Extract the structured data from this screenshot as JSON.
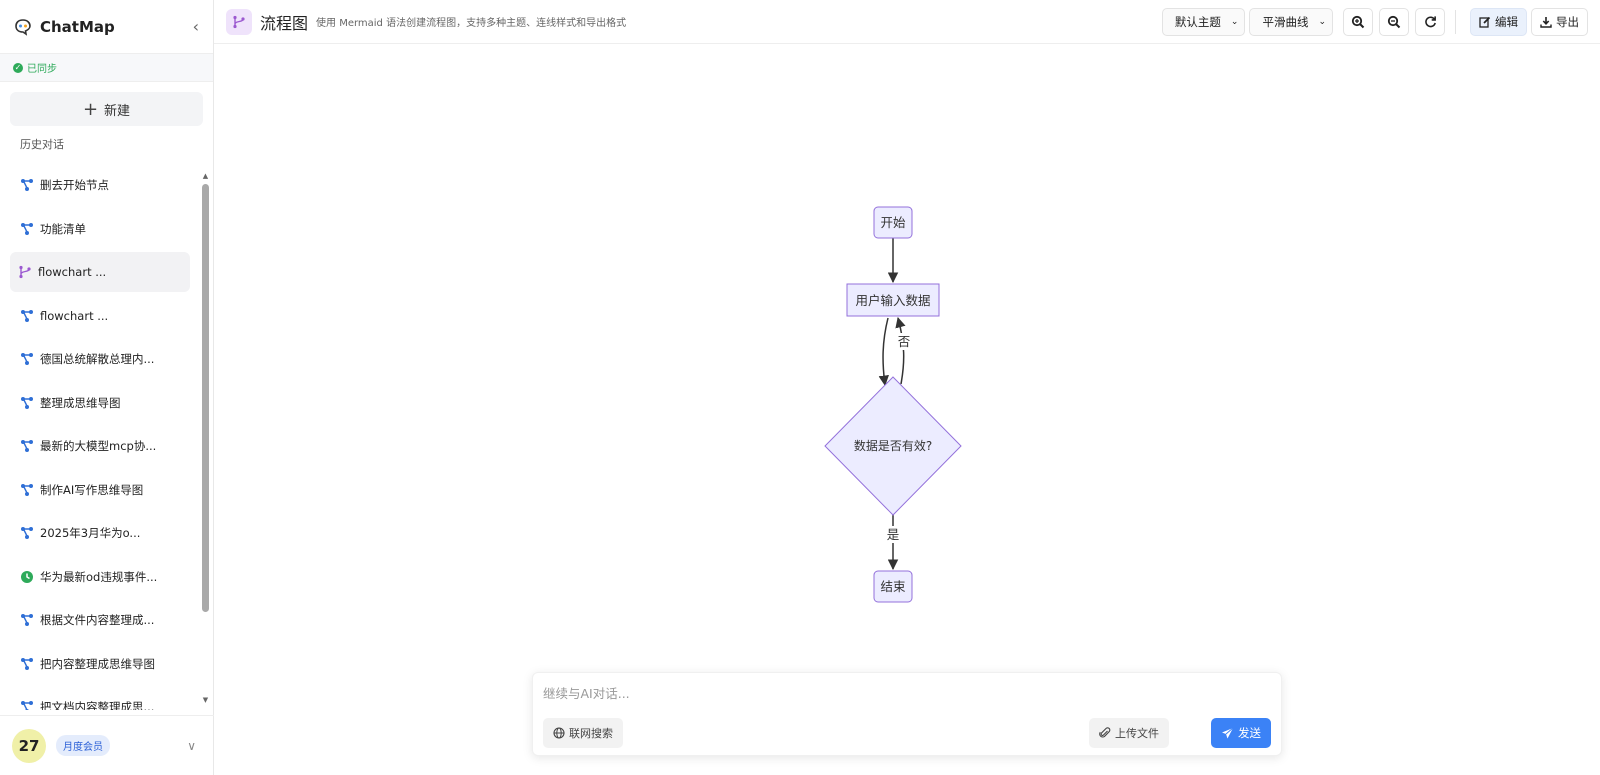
{
  "app": {
    "name": "ChatMap"
  },
  "sidebar": {
    "sync_status": "已同步",
    "new_label": "新建",
    "history_title": "历史对话",
    "items": [
      {
        "label": "删去开始节点",
        "icon": "mindmap-icon"
      },
      {
        "label": "功能清单",
        "icon": "mindmap-icon"
      },
      {
        "label": "flowchart ...",
        "icon": "flowchart-icon",
        "active": true
      },
      {
        "label": "flowchart ...",
        "icon": "mindmap-icon"
      },
      {
        "label": "德国总统解散总理内...",
        "icon": "mindmap-icon"
      },
      {
        "label": "整理成思维导图",
        "icon": "mindmap-icon"
      },
      {
        "label": "最新的大模型mcp协...",
        "icon": "mindmap-icon"
      },
      {
        "label": "制作AI写作思维导图",
        "icon": "mindmap-icon"
      },
      {
        "label": "2025年3月华为o...",
        "icon": "mindmap-icon"
      },
      {
        "label": "华为最新od违规事件...",
        "icon": "timeline-icon"
      },
      {
        "label": "根据文件内容整理成...",
        "icon": "mindmap-icon"
      },
      {
        "label": "把内容整理成思维导图",
        "icon": "mindmap-icon"
      },
      {
        "label": "把文档内容整理成思...",
        "icon": "mindmap-icon"
      }
    ],
    "user": {
      "avatar_text": "27",
      "membership": "月度会员"
    }
  },
  "toolbar": {
    "title": "流程图",
    "subtitle": "使用 Mermaid 语法创建流程图，支持多种主题、连线样式和导出格式",
    "theme_select": "默认主题",
    "curve_select": "平滑曲线",
    "edit_label": "编辑",
    "export_label": "导出"
  },
  "flowchart": {
    "nodes": {
      "start": "开始",
      "input": "用户输入数据",
      "decision": "数据是否有效?",
      "end": "结束"
    },
    "edges": {
      "no_label": "否",
      "yes_label": "是"
    }
  },
  "chat": {
    "placeholder": "继续与AI对话...",
    "web_search_label": "联网搜索",
    "upload_label": "上传文件",
    "send_label": "发送"
  },
  "colors": {
    "node_fill": "#ececff",
    "node_stroke": "#9370db",
    "accent_blue": "#3b82f6",
    "sync_green": "#2eaa5a",
    "flowchart_purple": "#9b59d0"
  }
}
